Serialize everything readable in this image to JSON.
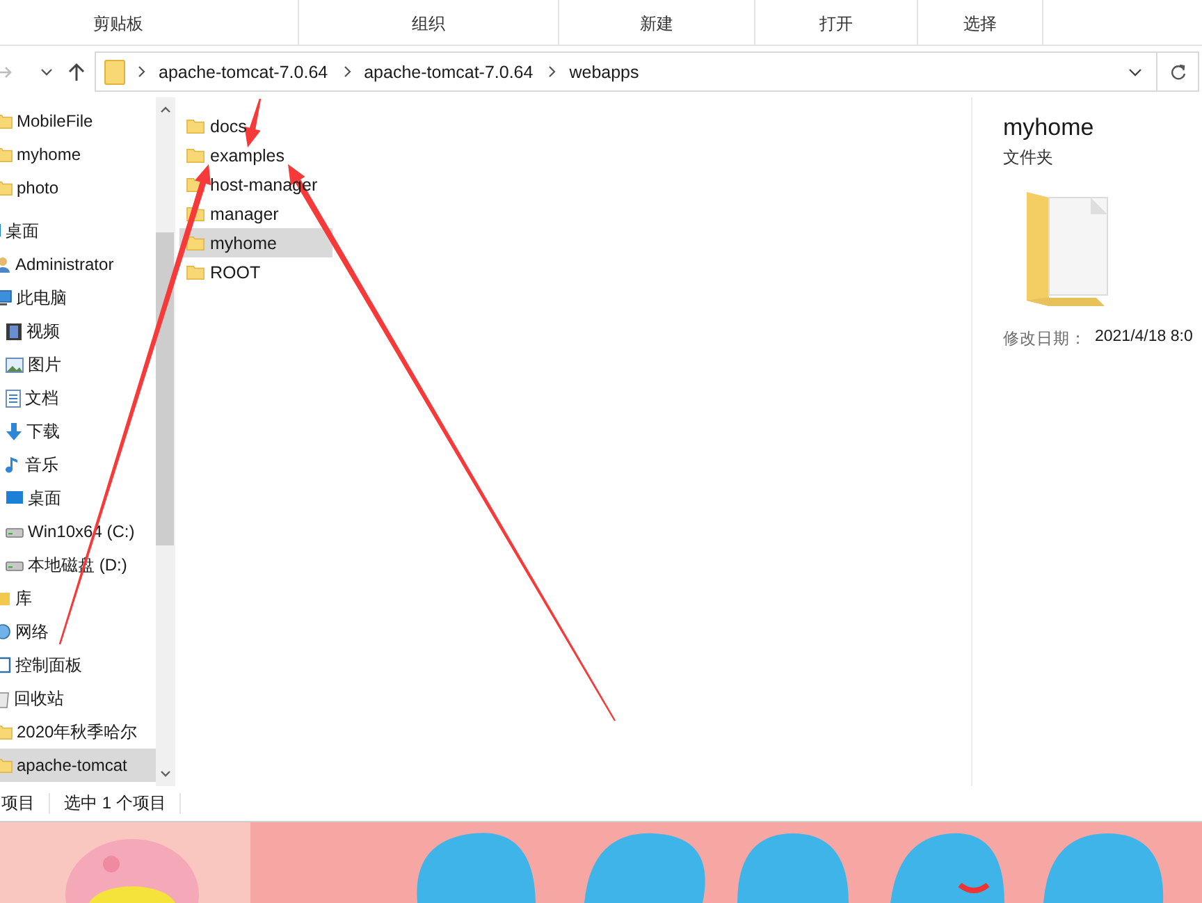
{
  "ribbon": {
    "groups": [
      "剪贴板",
      "组织",
      "新建",
      "打开",
      "选择"
    ]
  },
  "address_bar": {
    "path": [
      "apache-tomcat-7.0.64",
      "apache-tomcat-7.0.64",
      "webapps"
    ]
  },
  "sidebar": {
    "pinned": [
      {
        "label": "MobileFile",
        "kind": "folder",
        "selected": false
      },
      {
        "label": "myhome",
        "kind": "folder",
        "selected": false
      },
      {
        "label": "photo",
        "kind": "folder",
        "selected": false
      }
    ],
    "items": [
      {
        "label": "桌面",
        "kind": "desktop",
        "selected": false,
        "children": [
          {
            "label": "Administrator",
            "kind": "user",
            "selected": false
          },
          {
            "label": "此电脑",
            "kind": "computer",
            "selected": false,
            "children": [
              {
                "label": "视频",
                "kind": "video",
                "selected": false
              },
              {
                "label": "图片",
                "kind": "picture",
                "selected": false
              },
              {
                "label": "文档",
                "kind": "document",
                "selected": false
              },
              {
                "label": "下载",
                "kind": "download",
                "selected": false
              },
              {
                "label": "音乐",
                "kind": "music",
                "selected": false
              },
              {
                "label": "桌面",
                "kind": "desktop",
                "selected": false
              },
              {
                "label": "Win10x64 (C:)",
                "kind": "drive",
                "selected": false
              },
              {
                "label": "本地磁盘 (D:)",
                "kind": "drive",
                "selected": false
              }
            ]
          },
          {
            "label": "库",
            "kind": "library",
            "selected": false
          },
          {
            "label": "网络",
            "kind": "network",
            "selected": false
          },
          {
            "label": "控制面板",
            "kind": "control",
            "selected": false
          },
          {
            "label": "回收站",
            "kind": "recycle",
            "selected": false
          },
          {
            "label": "2020年秋季哈尔",
            "kind": "folder",
            "selected": false
          },
          {
            "label": "apache-tomcat",
            "kind": "folder",
            "selected": true
          }
        ]
      }
    ]
  },
  "files": [
    {
      "name": "docs",
      "selected": false
    },
    {
      "name": "examples",
      "selected": false
    },
    {
      "name": "host-manager",
      "selected": false
    },
    {
      "name": "manager",
      "selected": false
    },
    {
      "name": "myhome",
      "selected": true
    },
    {
      "name": "ROOT",
      "selected": false
    }
  ],
  "details": {
    "title": "myhome",
    "type": "文件夹",
    "fields": [
      {
        "label": "修改日期：",
        "value": "2021/4/18 8:0"
      }
    ]
  },
  "status_bar": {
    "item_count": "项目",
    "selection": "选中 1 个项目"
  },
  "annotations": [
    {
      "kind": "arrow"
    },
    {
      "kind": "arrow"
    },
    {
      "kind": "arrow"
    }
  ]
}
